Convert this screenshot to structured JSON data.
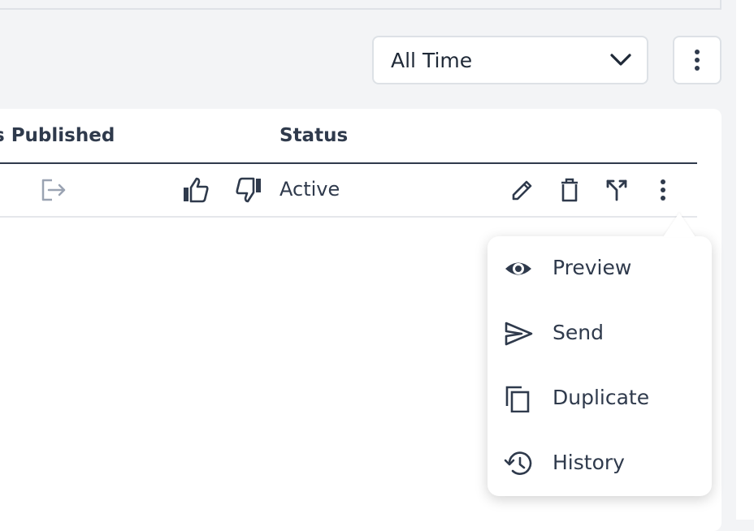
{
  "filter": {
    "date_range": "All Time",
    "chevron_icon": "chevron-down-icon",
    "more_icon": "kebab-vertical-icon"
  },
  "table": {
    "columns": [
      "s Published",
      "Status"
    ],
    "row": {
      "published_icon": "export-icon",
      "like_icon": "thumbs-up-icon",
      "dislike_icon": "thumbs-down-icon",
      "status": "Active",
      "actions": [
        "edit-icon",
        "delete-icon",
        "merge-icon",
        "kebab-vertical-icon"
      ]
    }
  },
  "context_menu": {
    "items": [
      {
        "label": "Preview",
        "icon": "eye-icon"
      },
      {
        "label": "Send",
        "icon": "send-icon"
      },
      {
        "label": "Duplicate",
        "icon": "copy-icon"
      },
      {
        "label": "History",
        "icon": "history-icon"
      }
    ]
  },
  "colors": {
    "text": "#2f3a4c",
    "border": "#dde1e6",
    "background": "#f3f4f6",
    "muted_icon": "#9aa3b2"
  }
}
